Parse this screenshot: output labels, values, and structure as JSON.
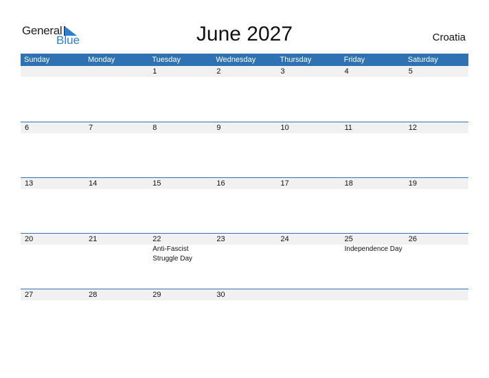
{
  "logo": {
    "text1": "General",
    "text2": "Blue"
  },
  "title": "June 2027",
  "country": "Croatia",
  "colors": {
    "header_bg": "#2e72b4",
    "day_row_bg": "#f1f1f1",
    "logo_blue": "#2a7fd0"
  },
  "weekdays": [
    "Sunday",
    "Monday",
    "Tuesday",
    "Wednesday",
    "Thursday",
    "Friday",
    "Saturday"
  ],
  "weeks": [
    {
      "days": [
        "",
        "",
        "1",
        "2",
        "3",
        "4",
        "5"
      ],
      "events": [
        "",
        "",
        "",
        "",
        "",
        "",
        ""
      ]
    },
    {
      "days": [
        "6",
        "7",
        "8",
        "9",
        "10",
        "11",
        "12"
      ],
      "events": [
        "",
        "",
        "",
        "",
        "",
        "",
        ""
      ]
    },
    {
      "days": [
        "13",
        "14",
        "15",
        "16",
        "17",
        "18",
        "19"
      ],
      "events": [
        "",
        "",
        "",
        "",
        "",
        "",
        ""
      ]
    },
    {
      "days": [
        "20",
        "21",
        "22",
        "23",
        "24",
        "25",
        "26"
      ],
      "events": [
        "",
        "",
        "Anti-Fascist Struggle Day",
        "",
        "",
        "Independence Day",
        ""
      ]
    },
    {
      "days": [
        "27",
        "28",
        "29",
        "30",
        "",
        "",
        ""
      ],
      "events": [
        "",
        "",
        "",
        "",
        "",
        "",
        ""
      ]
    }
  ]
}
